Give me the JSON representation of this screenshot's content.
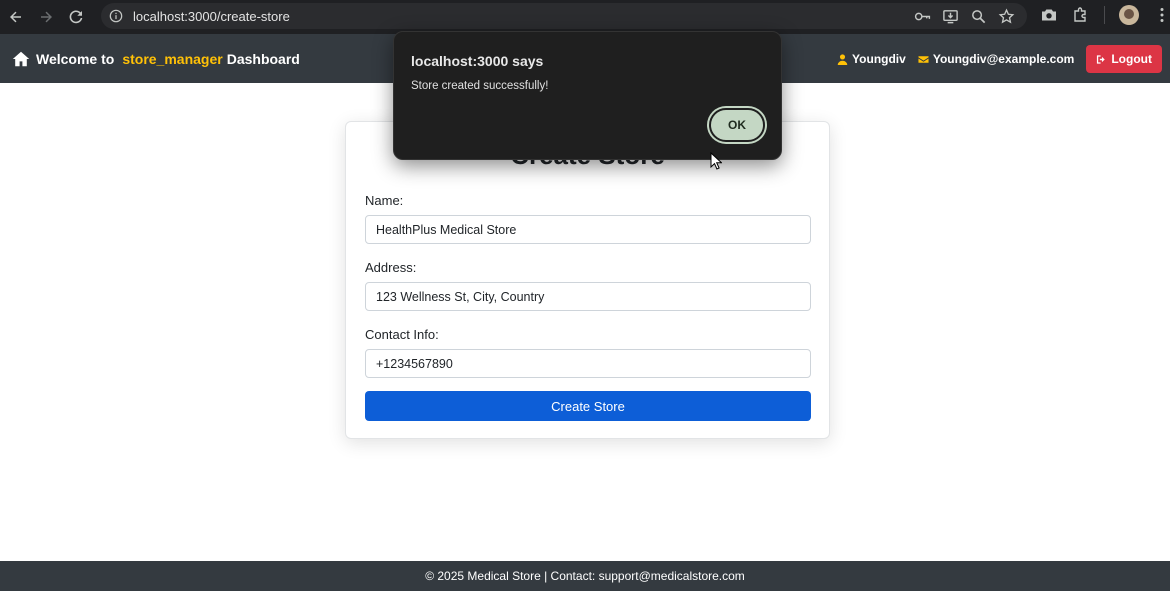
{
  "browser": {
    "url": "localhost:3000/create-store",
    "icons": [
      "back-icon",
      "forward-icon",
      "reload-icon",
      "site-info-icon",
      "password-key-icon",
      "install-app-icon",
      "zoom-icon",
      "bookmark-star-icon",
      "screenshot-camera-icon",
      "extensions-icon",
      "profile-avatar",
      "menu-kebab-icon"
    ]
  },
  "navbar": {
    "welcome": "Welcome to",
    "role": "store_manager",
    "dashboard": "Dashboard",
    "username": "Youngdiv",
    "email": "Youngdiv@example.com",
    "logout_label": "Logout"
  },
  "form": {
    "title": "Create Store",
    "name_label": "Name:",
    "name_value": "HealthPlus Medical Store",
    "address_label": "Address:",
    "address_value": "123 Wellness St, City, Country",
    "contact_label": "Contact Info:",
    "contact_value": "+1234567890",
    "submit_label": "Create Store"
  },
  "footer": {
    "text": "© 2025 Medical Store | Contact: support@medicalstore.com"
  },
  "dialog": {
    "title": "localhost:3000 says",
    "message": "Store created successfully!",
    "ok_label": "OK"
  },
  "colors": {
    "navbar_bg": "#343a40",
    "brand_highlight": "#ffc107",
    "logout_bg": "#dc3545",
    "primary": "#0d5ed7",
    "dialog_bg": "#1f1f1f",
    "ok_button": "#c4d7c4"
  }
}
